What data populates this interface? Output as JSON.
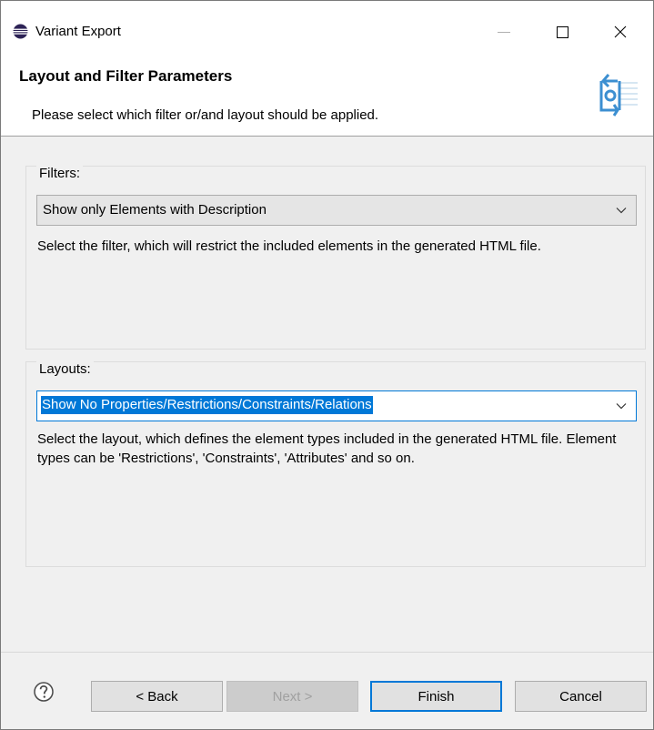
{
  "window": {
    "title": "Variant Export"
  },
  "header": {
    "title": "Layout and Filter Parameters",
    "description": "Please select which filter or/and layout should be applied."
  },
  "filters": {
    "group_label": "Filters:",
    "selected": "Show only Elements with Description",
    "description": "Select the filter, which will restrict the included elements in the generated HTML file."
  },
  "layouts": {
    "group_label": "Layouts:",
    "selected": "Show No Properties/Restrictions/Constraints/Relations",
    "description": "Select the layout, which defines the element types included in the generated HTML file. Element types can be 'Restrictions', 'Constraints', 'Attributes' and so on."
  },
  "buttons": {
    "back": "< Back",
    "next": "Next >",
    "finish": "Finish",
    "cancel": "Cancel"
  },
  "colors": {
    "accent": "#0078d7",
    "dialog_bg": "#f0f0f0",
    "app_icon": "#3a3a8c"
  },
  "icons": {
    "app": "eclipse-icon",
    "header": "export-refresh-icon",
    "help": "help-icon"
  }
}
